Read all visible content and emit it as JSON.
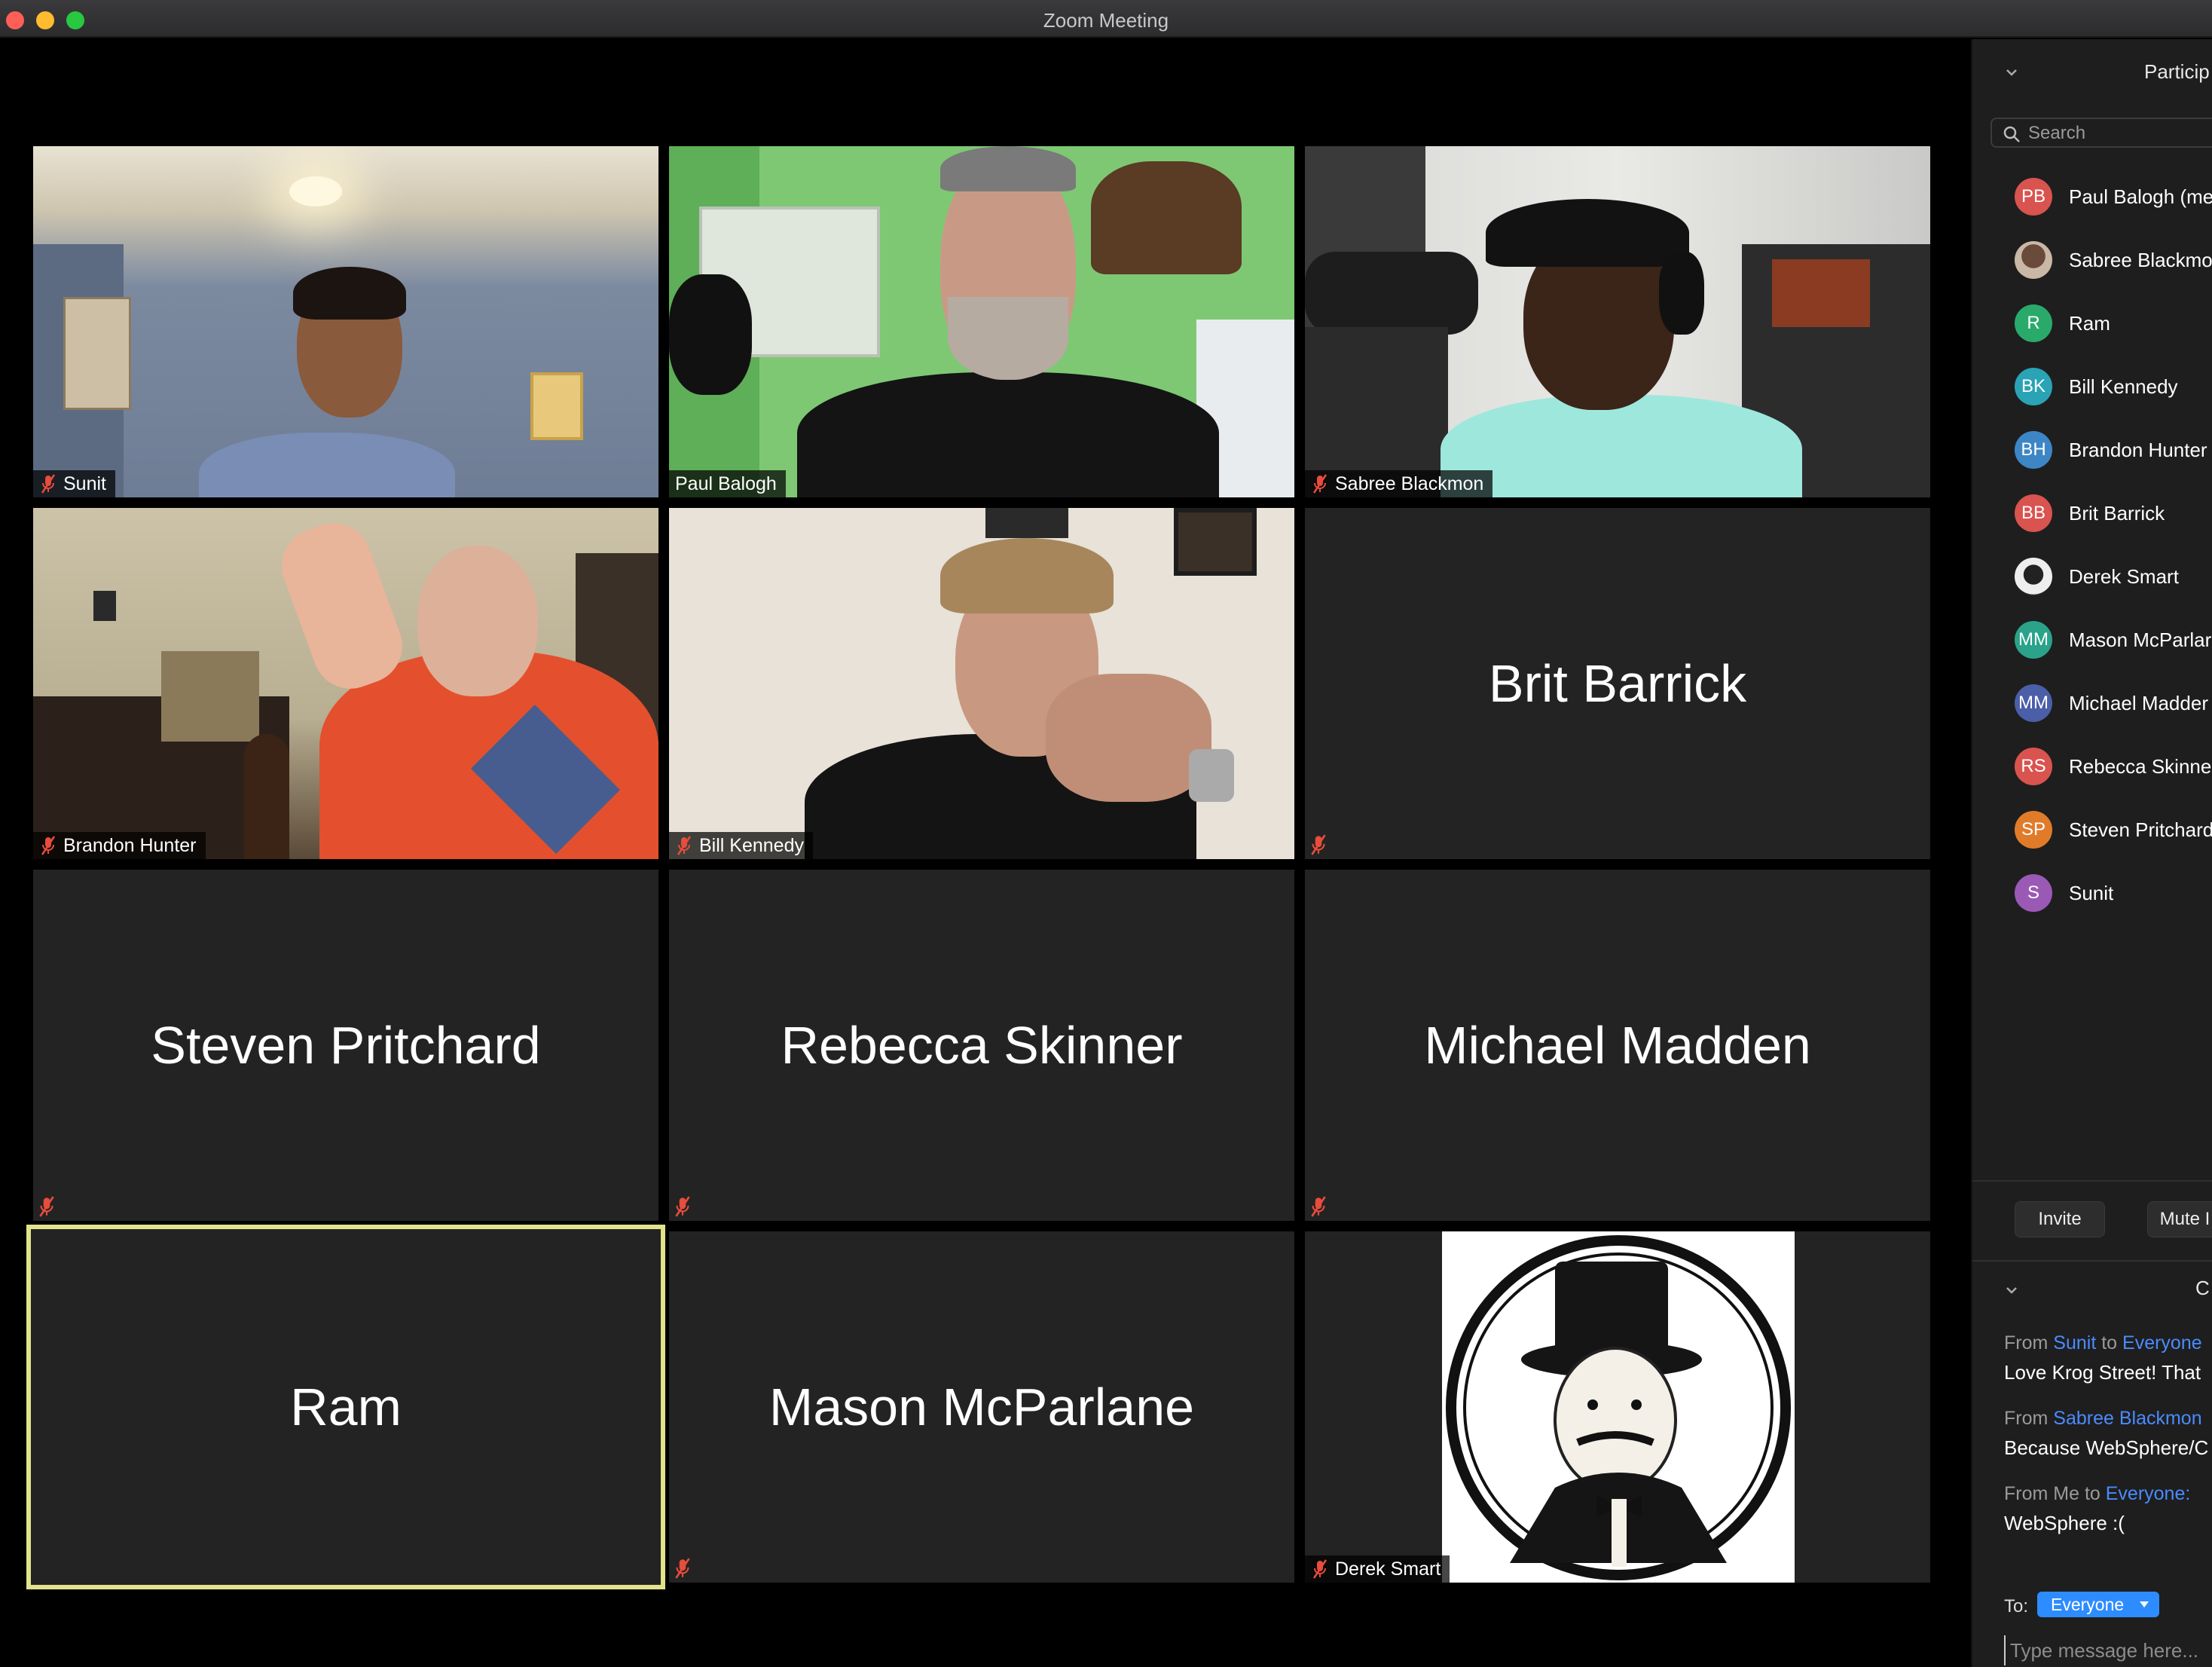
{
  "window": {
    "title": "Zoom Meeting"
  },
  "tiles": [
    {
      "id": "sunit",
      "label": "Sunit",
      "type": "video",
      "muted": true
    },
    {
      "id": "paul",
      "label": "Paul Balogh",
      "type": "video",
      "muted": false
    },
    {
      "id": "sabree",
      "label": "Sabree Blackmon",
      "type": "video",
      "muted": true
    },
    {
      "id": "brandon",
      "label": "Brandon Hunter",
      "type": "video",
      "muted": true
    },
    {
      "id": "bill",
      "label": "Bill Kennedy",
      "type": "video",
      "muted": true
    },
    {
      "id": "brit",
      "label": "Brit Barrick",
      "type": "name",
      "muted": true
    },
    {
      "id": "steven",
      "label": "Steven Pritchard",
      "type": "name",
      "muted": true
    },
    {
      "id": "rebecca",
      "label": "Rebecca Skinner",
      "type": "name",
      "muted": true
    },
    {
      "id": "michael",
      "label": "Michael Madden",
      "type": "name",
      "muted": true
    },
    {
      "id": "ram",
      "label": "Ram",
      "type": "name",
      "muted": false,
      "active_speaker": true
    },
    {
      "id": "mason",
      "label": "Mason McParlane",
      "type": "name",
      "muted": true
    },
    {
      "id": "derek",
      "label": "Derek Smart",
      "type": "image",
      "muted": true
    }
  ],
  "panel": {
    "title": "Particip",
    "search_placeholder": "Search",
    "participants": [
      {
        "initials": "PB",
        "name": "Paul Balogh (me",
        "color": "#d9534f"
      },
      {
        "initials": "",
        "name": "Sabree Blackmo",
        "color": "#8a6d5a",
        "photo": true
      },
      {
        "initials": "R",
        "name": "Ram",
        "color": "#2aaa6a"
      },
      {
        "initials": "BK",
        "name": "Bill Kennedy",
        "color": "#2aa3b5"
      },
      {
        "initials": "BH",
        "name": "Brandon Hunter",
        "color": "#3d86c6"
      },
      {
        "initials": "BB",
        "name": "Brit Barrick",
        "color": "#d9534f"
      },
      {
        "initials": "",
        "name": "Derek Smart",
        "color": "#eeeeee",
        "photo": true
      },
      {
        "initials": "MM",
        "name": "Mason McParlar",
        "color": "#2aa38a"
      },
      {
        "initials": "MM",
        "name": "Michael Madder",
        "color": "#4b5ea8"
      },
      {
        "initials": "RS",
        "name": "Rebecca Skinne",
        "color": "#d9534f"
      },
      {
        "initials": "SP",
        "name": "Steven Pritchard",
        "color": "#e07b2a"
      },
      {
        "initials": "S",
        "name": "Sunit",
        "color": "#9b59b6"
      }
    ],
    "invite_label": "Invite",
    "mute_label": "Mute I"
  },
  "chat": {
    "title": "C",
    "messages": [
      {
        "from_prefix": "From ",
        "sender": "Sunit",
        "to_prefix": " to ",
        "recipient": "Everyone",
        "text": "Love Krog Street! That"
      },
      {
        "from_prefix": "From ",
        "sender": "Sabree Blackmon",
        "to_prefix": "",
        "recipient": "",
        "text": "Because WebSphere/C"
      },
      {
        "from_prefix": "From Me to ",
        "sender": "",
        "to_prefix": "",
        "recipient": "Everyone:",
        "text": "WebSphere :("
      }
    ],
    "to_label": "To:",
    "to_value": "Everyone",
    "input_placeholder": "Type message here..."
  }
}
